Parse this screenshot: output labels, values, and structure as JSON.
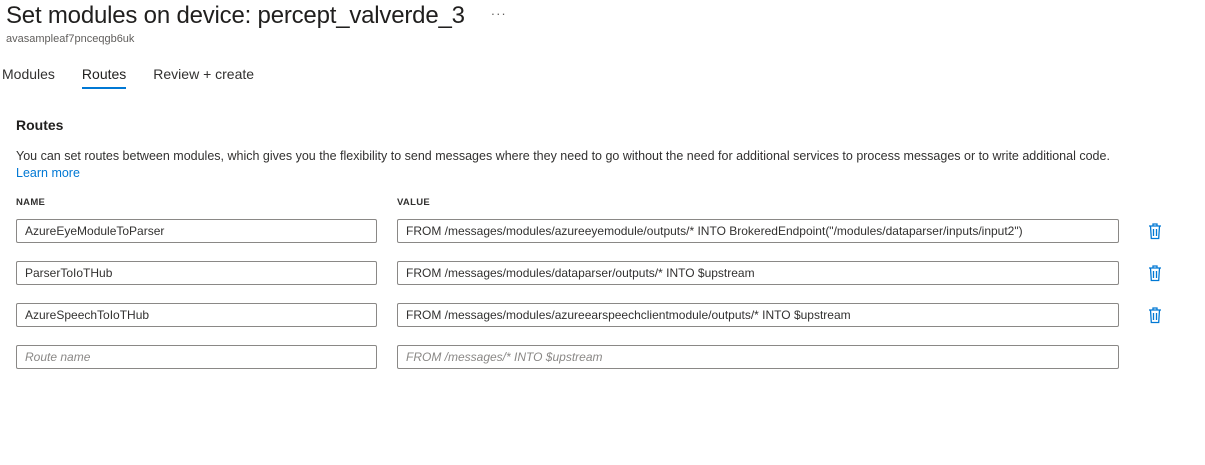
{
  "header": {
    "title": "Set modules on device: percept_valverde_3",
    "more_label": "···",
    "subtitle": "avasampleaf7pnceqgb6uk"
  },
  "tabs": [
    {
      "label": "Modules",
      "active": false
    },
    {
      "label": "Routes",
      "active": true
    },
    {
      "label": "Review + create",
      "active": false
    }
  ],
  "routes_section": {
    "title": "Routes",
    "description": "You can set routes between modules, which gives you the flexibility to send messages where they need to go without the need for additional services to process messages or to write additional code.",
    "learn_more": "Learn more",
    "columns": {
      "name": "NAME",
      "value": "VALUE"
    },
    "routes": [
      {
        "name": "AzureEyeModuleToParser",
        "value": "FROM /messages/modules/azureeyemodule/outputs/* INTO BrokeredEndpoint(\"/modules/dataparser/inputs/input2\")"
      },
      {
        "name": "ParserToIoTHub",
        "value": "FROM /messages/modules/dataparser/outputs/* INTO $upstream"
      },
      {
        "name": "AzureSpeechToIoTHub",
        "value": "FROM /messages/modules/azureearspeechclientmodule/outputs/* INTO $upstream"
      }
    ],
    "new_route": {
      "name_placeholder": "Route name",
      "value_placeholder": "FROM /messages/* INTO $upstream"
    }
  },
  "colors": {
    "accent": "#0078d4",
    "border": "#8a8886",
    "text": "#323130"
  },
  "icons": {
    "delete": "trash-icon",
    "more": "ellipsis-icon"
  }
}
